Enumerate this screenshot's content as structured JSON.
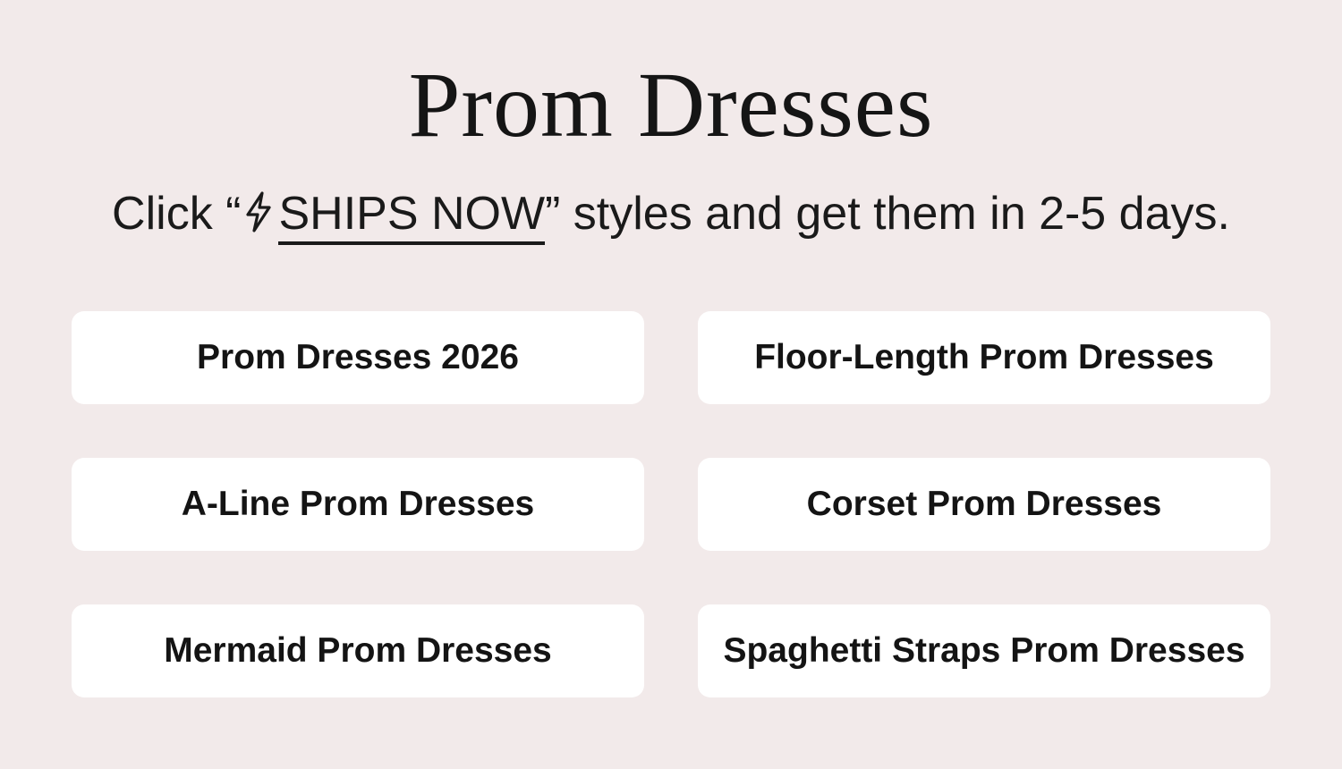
{
  "page": {
    "title": "Prom Dresses",
    "subtitle": {
      "prefix": "Click “",
      "icon": "lightning-bolt-icon",
      "link_label": "SHIPS NOW",
      "suffix": "” styles and get them in 2-5 days."
    }
  },
  "categories": [
    {
      "label": "Prom Dresses 2026"
    },
    {
      "label": "Floor-Length Prom Dresses"
    },
    {
      "label": "A-Line Prom Dresses"
    },
    {
      "label": "Corset Prom Dresses"
    },
    {
      "label": "Mermaid Prom Dresses"
    },
    {
      "label": "Spaghetti Straps Prom Dresses"
    }
  ],
  "colors": {
    "background": "#f2eaea",
    "button_background": "#ffffff",
    "text": "#141414"
  }
}
